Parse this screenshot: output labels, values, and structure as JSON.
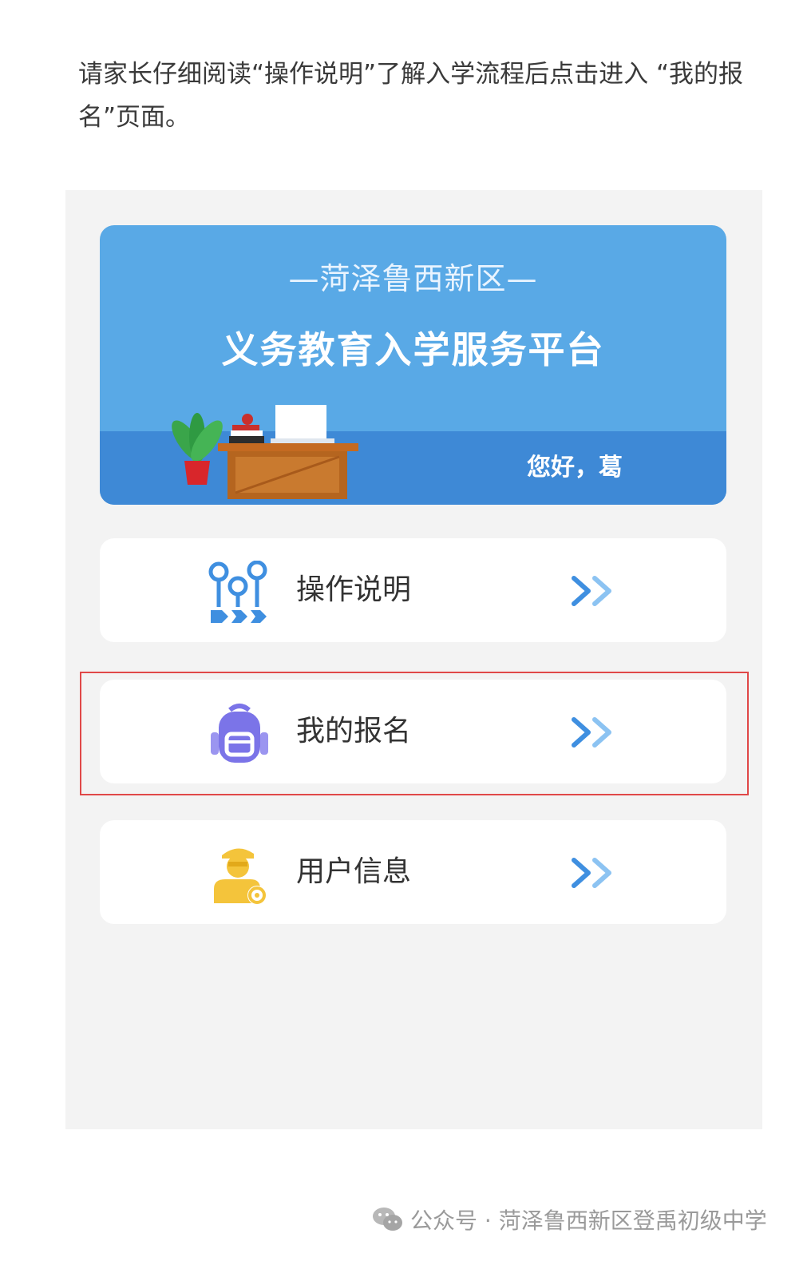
{
  "instruction_text": "请家长仔细阅读“操作说明”了解入学流程后点击进入 “我的报名”页面。",
  "banner": {
    "region": "—菏泽鲁西新区—",
    "title": "义务教育入学服务平台",
    "greeting": "您好，葛"
  },
  "menu": [
    {
      "label": "操作说明",
      "icon": "flow-chart-icon",
      "color": "#3f8fe0"
    },
    {
      "label": "我的报名",
      "icon": "backpack-icon",
      "color": "#7b74e8"
    },
    {
      "label": "用户信息",
      "icon": "user-settings-icon",
      "color": "#f4c43b"
    }
  ],
  "highlighted_item": "我的报名",
  "footer": {
    "icon": "wechat-icon",
    "text": "公众号 · 菏泽鲁西新区登禹初级中学"
  },
  "colors": {
    "banner_blue": "#59a9e6",
    "arrow_blue": "#3f8fe0",
    "highlight_red": "#e04848",
    "background_gray": "#f3f3f3"
  }
}
